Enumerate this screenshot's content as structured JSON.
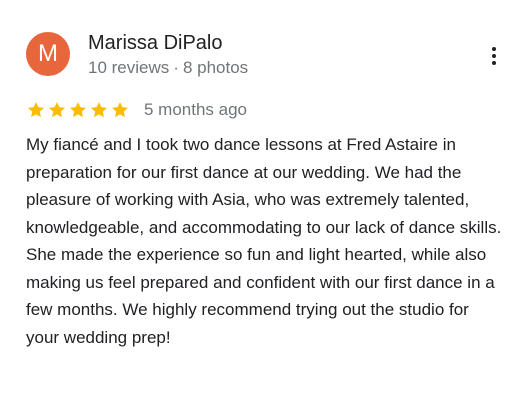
{
  "reviewer": {
    "initial": "M",
    "name": "Marissa DiPalo",
    "reviews_count": "10 reviews",
    "separator": "·",
    "photos_count": "8 photos",
    "avatar_color": "#e8663b"
  },
  "rating": {
    "stars": 5,
    "max_stars": 5,
    "star_color": "#fbbc04",
    "time_ago": "5 months ago"
  },
  "review": {
    "text": "My fiancé and I took two dance lessons at Fred Astaire in preparation for our first dance at our wedding. We had the pleasure of working with Asia, who was extremely talented, knowledgeable, and accommodating to our lack of dance skills. She made the experience so fun and light hearted, while also making us feel prepared and confident with our first dance in a few months. We highly recommend trying out the studio for your wedding prep!"
  },
  "icons": {
    "more": "more-vert-icon",
    "star": "star-icon"
  }
}
